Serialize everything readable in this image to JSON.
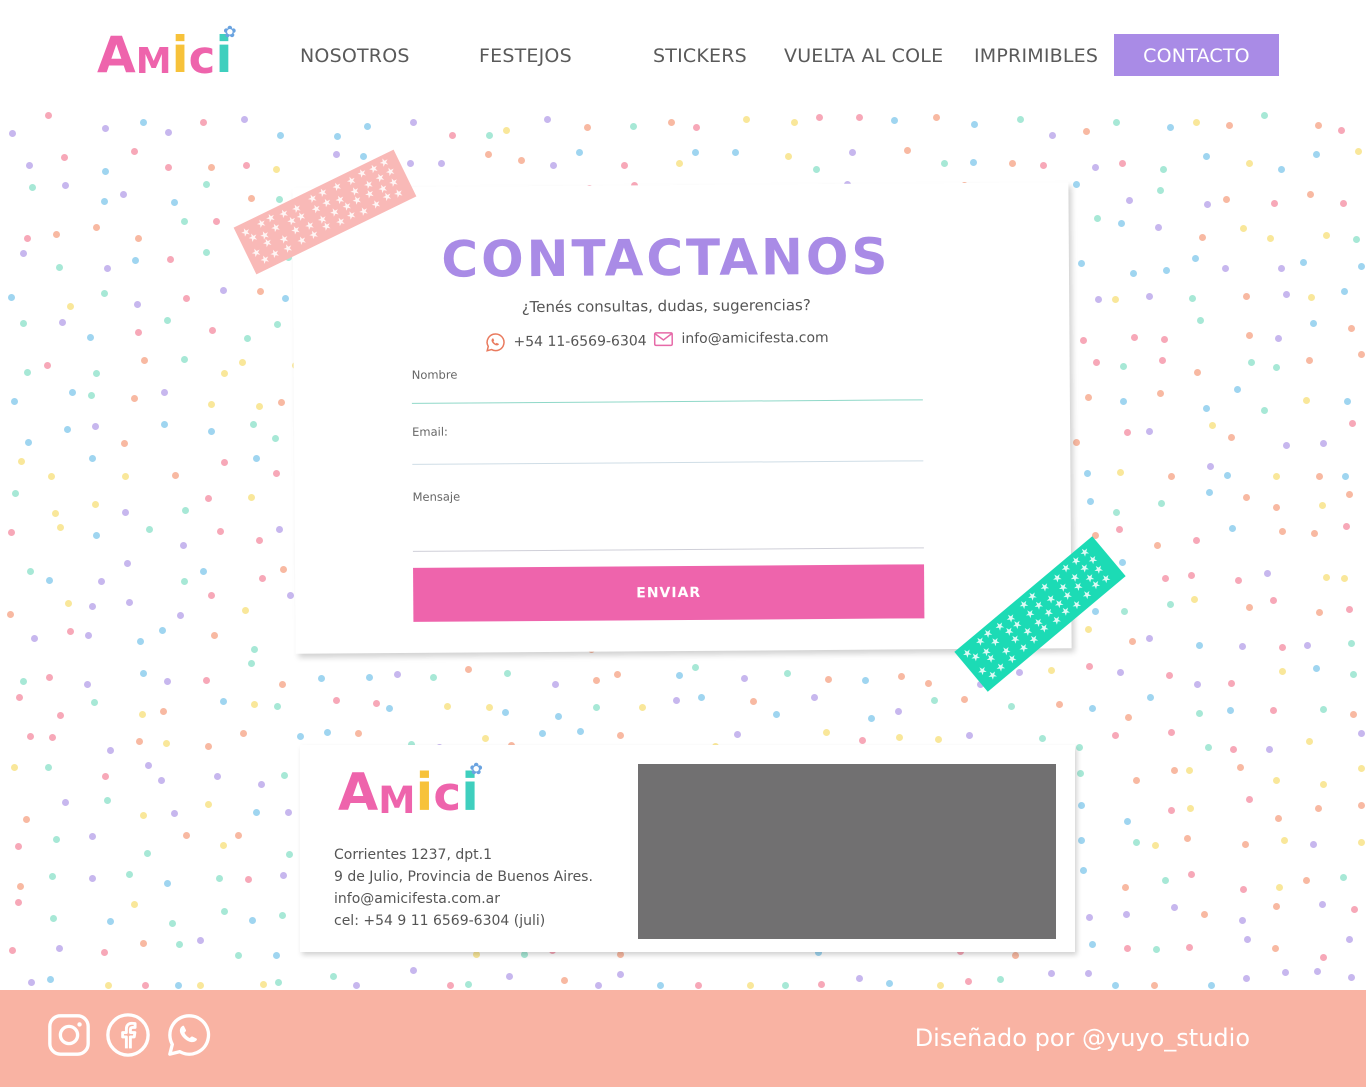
{
  "brand": {
    "logo_letters": [
      "A",
      "M",
      "i",
      "c",
      "i"
    ],
    "logo_colors": [
      "#ee64ac",
      "#ee64ac",
      "#f7c23a",
      "#ee64ac",
      "#3fcfbe"
    ],
    "flower_icon": "flower-icon",
    "flower_color": "#6aa3e0"
  },
  "nav": {
    "items": [
      {
        "label": "NOSOTROS"
      },
      {
        "label": "FESTEJOS"
      },
      {
        "label": "STICKERS"
      },
      {
        "label": "VUELTA AL COLE"
      },
      {
        "label": "IMPRIMIBLES"
      },
      {
        "label": "CONTACTO",
        "active": true
      }
    ]
  },
  "contact": {
    "title": "CONTACTANOS",
    "subtitle": "¿Tenés consultas, dudas, sugerencias?",
    "phone": "+54 11-6569-6304",
    "phone_icon": "whatsapp-icon",
    "email": "info@amicifesta.com",
    "email_icon": "mail-icon",
    "form": {
      "name_label": "Nombre",
      "name_value": "",
      "email_label": "Email:",
      "email_value": "",
      "message_label": "Mensaje",
      "message_value": "",
      "submit_label": "ENVIAR"
    }
  },
  "info": {
    "address_line1": "Corrientes 1237, dpt.1",
    "address_line2": "9 de Julio, Provincia de Buenos Aires.",
    "email": "info@amicifesta.com.ar",
    "cel": "cel: +54 9 11 6569-6304 (juli)"
  },
  "footer": {
    "social_icons": [
      "instagram-icon",
      "facebook-icon",
      "whatsapp-icon"
    ],
    "credit": "Diseñado por @yuyo_studio"
  },
  "colors": {
    "accent_purple": "#a98be6",
    "pink": "#ee64ac",
    "footer_bg": "#f9b3a3",
    "mint_line": "#8fd8c8",
    "tape_pink": "#f9b9b7",
    "tape_teal": "#1cdbb5",
    "dot_palette": [
      "#f7a8b8",
      "#9fd5f0",
      "#a7e8d6",
      "#f9e79a",
      "#f8b9a2",
      "#c7b7ee"
    ]
  }
}
